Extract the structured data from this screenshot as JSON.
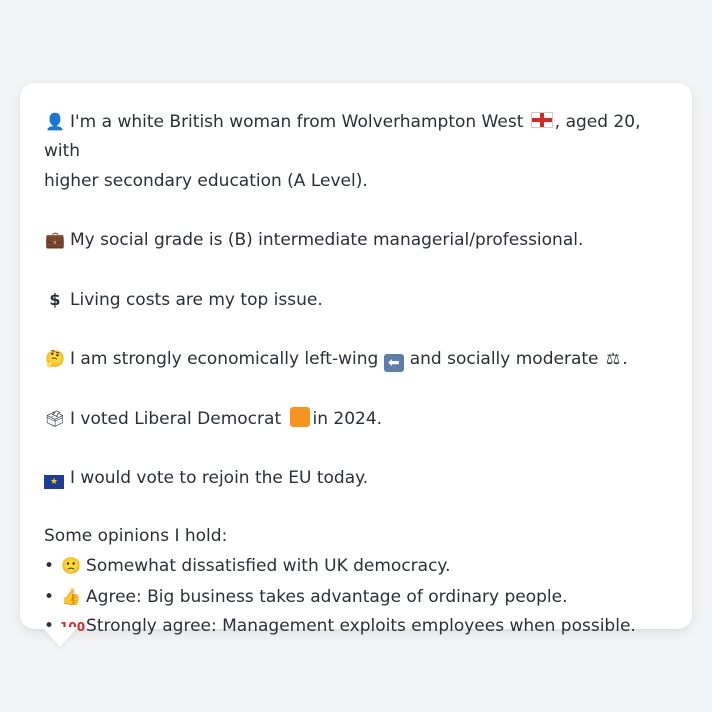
{
  "profile": {
    "line1_prefix": "I'm a white British woman from Wolverhampton West",
    "line1_suffix": ", aged 20, with",
    "line1_cont": "higher secondary education (A Level).",
    "social_grade": "My social grade is (B) intermediate managerial/professional.",
    "top_issue": "Living costs are my top issue.",
    "ideology_part1": "I am strongly economically left-wing",
    "ideology_part2": "and socially moderate",
    "ideology_end": ".",
    "vote_part1": "I voted Liberal Democrat",
    "vote_part2": "in 2024.",
    "eu": "I would vote to rejoin the EU today.",
    "opinions_title": "Some opinions I hold:",
    "opinions": [
      "Somewhat dissatisfied with UK democracy.",
      "Agree: Big business takes advantage of ordinary people.",
      "Strongly agree: Management exploits employees when possible."
    ]
  },
  "icons": {
    "person": "person-icon",
    "briefcase": "briefcase-icon",
    "dollar": "dollar-icon",
    "thinking": "thinking-face-icon",
    "left_arrow": "left-arrow-icon",
    "scales": "scales-icon",
    "ballot": "ballot-box-icon",
    "orange_square": "orange-square-icon",
    "eu_flag": "eu-flag-icon",
    "england_flag": "england-flag-icon",
    "slightly_frowning": "slightly-frowning-face-icon",
    "thumbs_up": "thumbs-up-icon",
    "hundred": "hundred-points-icon"
  },
  "colors": {
    "background": "#f3f4f6",
    "bubble": "#ffffff",
    "text": "#2b2f36",
    "liberal_democrat": "#f7941d"
  }
}
